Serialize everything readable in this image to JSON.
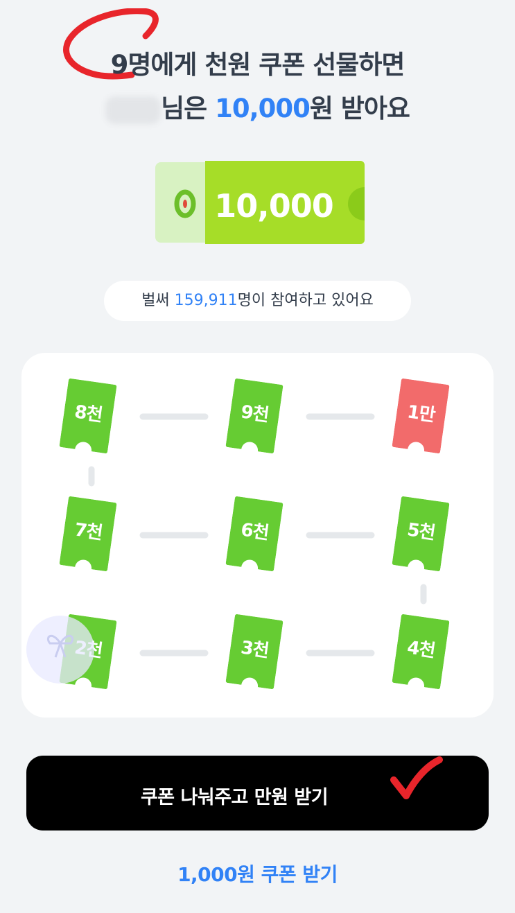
{
  "headline": {
    "line1": "9명에게 천원 쿠폰 선물하면",
    "line2_suffix": "님은",
    "line2_amount": "10,000",
    "line2_end": "원 받아요"
  },
  "coupon": {
    "value": "10,000",
    "logo_letter": "O"
  },
  "participants": {
    "prefix": "벌써",
    "count": "159,911",
    "suffix": "명이 참여하고 있어요"
  },
  "board": {
    "tickets": [
      {
        "label": "8천",
        "color": "#66CC33"
      },
      {
        "label": "9천",
        "color": "#66CC33"
      },
      {
        "label": "1만",
        "color": "#F26B6B"
      },
      {
        "label": "7천",
        "color": "#66CC33"
      },
      {
        "label": "6천",
        "color": "#66CC33"
      },
      {
        "label": "5천",
        "color": "#66CC33"
      },
      {
        "label": "2천",
        "color": "#66CC33"
      },
      {
        "label": "3천",
        "color": "#66CC33"
      },
      {
        "label": "4천",
        "color": "#66CC33"
      }
    ]
  },
  "cta": {
    "label": "쿠폰 나눠주고 만원 받기"
  },
  "secondary": {
    "label": "1,000원 쿠폰 받기"
  },
  "colors": {
    "accent": "#3182F6",
    "green": "#66CC33",
    "red": "#F26B6B",
    "background": "#F2F4F6"
  },
  "icons": {
    "annotation_circle": "red-circle-icon",
    "annotation_check": "red-check-icon",
    "avatar": "gift-ribbon-icon"
  }
}
